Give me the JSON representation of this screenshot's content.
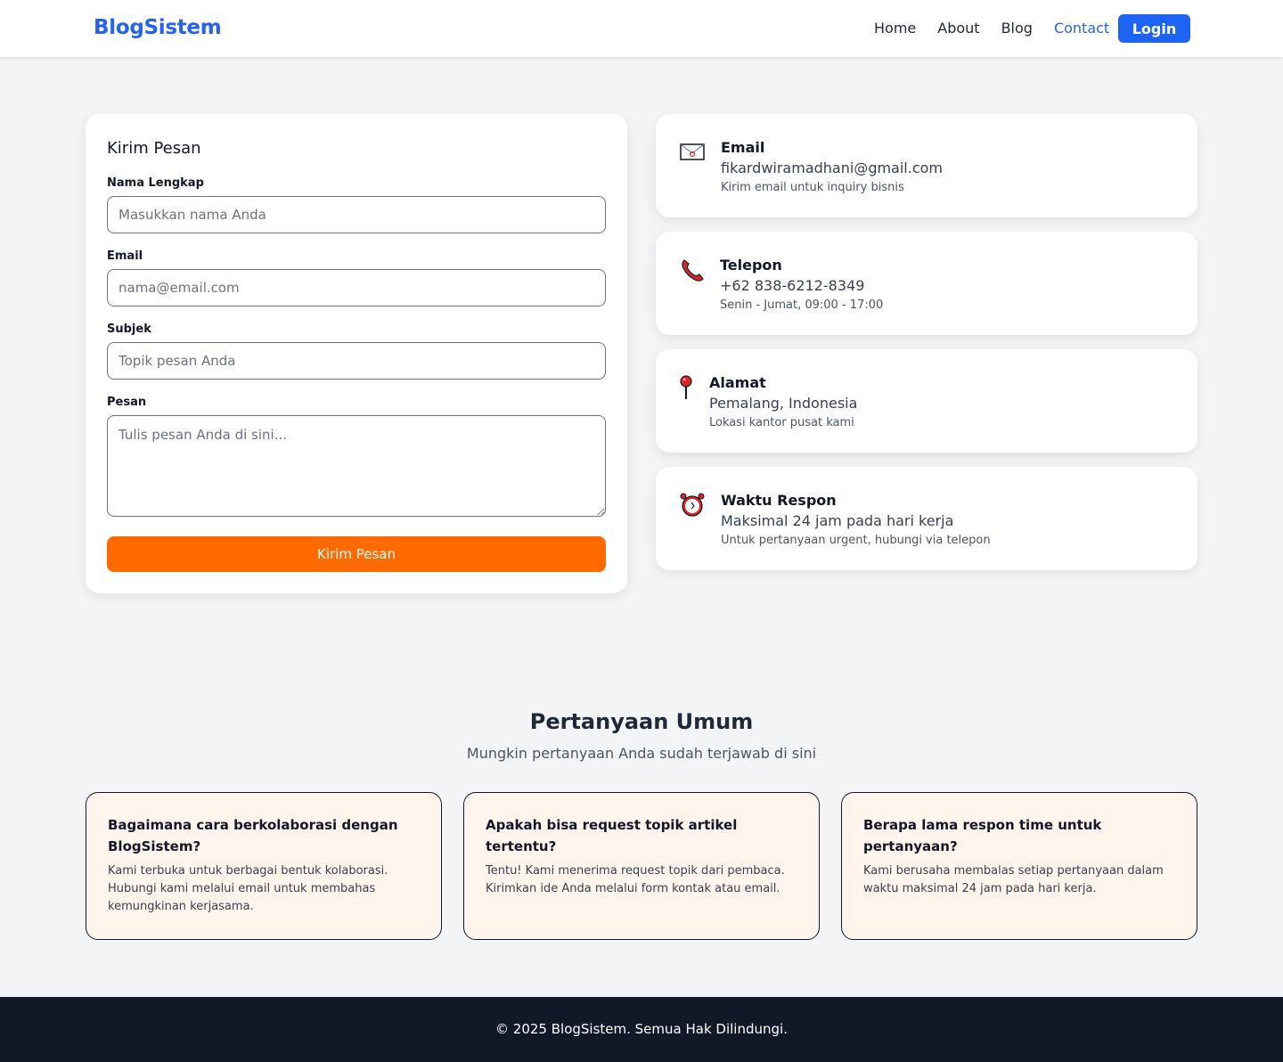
{
  "brand": "BlogSistem",
  "nav": {
    "links": [
      "Home",
      "About",
      "Blog",
      "Contact"
    ],
    "login_label": "Login"
  },
  "form": {
    "title": "Kirim Pesan",
    "name_label": "Nama Lengkap",
    "name_placeholder": "Masukkan nama Anda",
    "email_label": "Email",
    "email_placeholder": "nama@email.com",
    "subject_label": "Subjek",
    "subject_placeholder": "Topik pesan Anda",
    "message_label": "Pesan",
    "message_placeholder": "Tulis pesan Anda di sini...",
    "submit_label": "Kirim Pesan"
  },
  "info": [
    {
      "title": "Email",
      "value": "fikardwiramadhani@gmail.com",
      "desc": "Kirim email untuk inquiry bisnis",
      "icon": "envelope-icon"
    },
    {
      "title": "Telepon",
      "value": "+62 838-6212-8349",
      "desc": "Senin - Jumat, 09:00 - 17:00",
      "icon": "phone-icon"
    },
    {
      "title": "Alamat",
      "value": "Pemalang, Indonesia",
      "desc": "Lokasi kantor pusat kami",
      "icon": "pin-icon"
    },
    {
      "title": "Waktu Respon",
      "value": "Maksimal 24 jam pada hari kerja",
      "desc": "Untuk pertanyaan urgent, hubungi via telepon",
      "icon": "alarm-clock-icon"
    }
  ],
  "faq": {
    "title": "Pertanyaan Umum",
    "subtitle": "Mungkin pertanyaan Anda sudah terjawab di sini",
    "items": [
      {
        "q": "Bagaimana cara berkolaborasi dengan BlogSistem?",
        "a": "Kami terbuka untuk berbagai bentuk kolaborasi. Hubungi kami melalui email untuk membahas kemungkinan kerjasama."
      },
      {
        "q": "Apakah bisa request topik artikel tertentu?",
        "a": "Tentu! Kami menerima request topik dari pembaca. Kirimkan ide Anda melalui form kontak atau email."
      },
      {
        "q": "Berapa lama respon time untuk pertanyaan?",
        "a": "Kami berusaha membalas setiap pertanyaan dalam waktu maksimal 24 jam pada hari kerja."
      }
    ]
  },
  "footer": "© 2025 BlogSistem. Semua Hak Dilindungi.",
  "colors": {
    "primary": "#2563eb",
    "accent": "#ff6b00",
    "footer_bg": "#111827",
    "faq_bg": "#fff5ec"
  }
}
